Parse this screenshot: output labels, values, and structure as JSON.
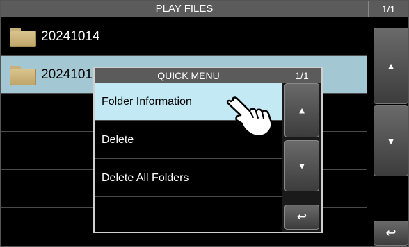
{
  "header": {
    "title": "PLAY FILES",
    "page": "1/1"
  },
  "files": [
    {
      "name": "20241014",
      "icon": "folder-icon",
      "selected": false
    },
    {
      "name": "2024101",
      "icon": "folder-icon",
      "selected": true
    }
  ],
  "side_buttons": {
    "up": "▲",
    "down": "▼",
    "back": "↩"
  },
  "quick_menu": {
    "title": "QUICK MENU",
    "page": "1/1",
    "items": [
      {
        "label": "Folder Information",
        "active": true
      },
      {
        "label": "Delete",
        "active": false
      },
      {
        "label": "Delete All Folders",
        "active": false
      }
    ],
    "buttons": {
      "up": "▲",
      "down": "▼",
      "back": "↩"
    }
  },
  "colors": {
    "selected_row": "#a3c8d4",
    "active_menu_item": "#c2e9f4",
    "title_bar": "#5b5b5b"
  }
}
